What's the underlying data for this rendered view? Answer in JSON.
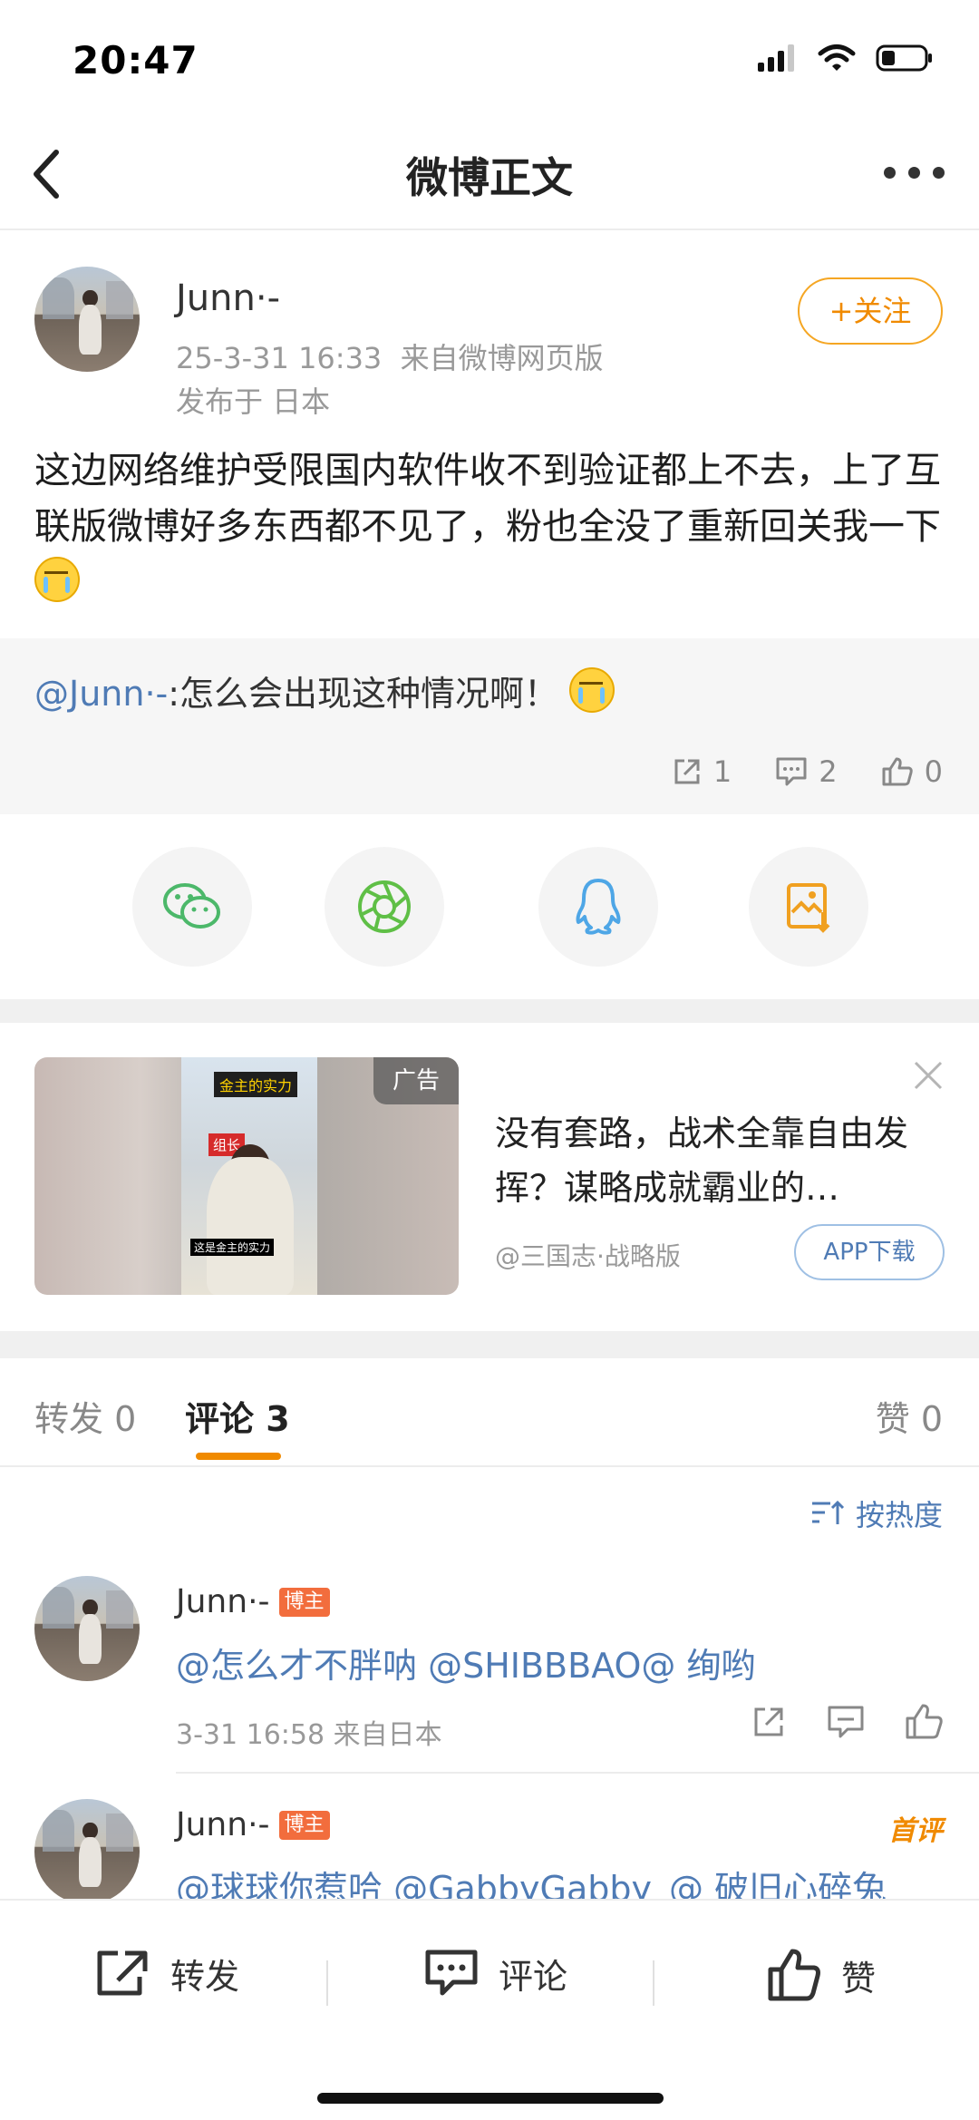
{
  "status_bar": {
    "time": "20:47"
  },
  "nav": {
    "title": "微博正文"
  },
  "post": {
    "author": "Junn·-",
    "timestamp": "25-3-31 16:33",
    "source": "来自微博网页版",
    "location": "发布于 日本",
    "follow_label": "+关注",
    "text": "这边网络维护受限国内软件收不到验证都上不去，上了互联版微博好多东西都不见了，粉也全没了重新回关我一下"
  },
  "quote": {
    "mention": "@Junn·-",
    "text": ":怎么会出现这种情况啊！",
    "reposts": "1",
    "comments": "2",
    "likes": "0"
  },
  "ad": {
    "badge": "广告",
    "title": "没有套路，战术全靠自由发挥？谋略成就霸业的…",
    "source": "@三国志·战略版",
    "button": "APP下载",
    "image_tag_1": "金主的实力",
    "image_tag_2": "组长",
    "image_subtitle": "这是金主的实力"
  },
  "tabs": {
    "repost_label": "转发",
    "repost_count": "0",
    "comment_label": "评论",
    "comment_count": "3",
    "like_label": "赞",
    "like_count": "0"
  },
  "sort_label": "按热度",
  "comments": [
    {
      "author": "Junn·-",
      "badge": "博主",
      "text": "@怎么才不胖呐 @SHIBBBAO@ 绚哟",
      "meta": "3-31 16:58  来自日本"
    },
    {
      "author": "Junn·-",
      "badge": "博主",
      "tag": "首评",
      "text": "@球球你惹哈 @GabbyGabby_@ 破旧心碎兔"
    }
  ],
  "bottom_bar": {
    "repost": "转发",
    "comment": "评论",
    "like": "赞"
  },
  "colors": {
    "accent_orange": "#f08a00",
    "link_blue": "#4f7bb5",
    "host_badge": "#f26d3d"
  }
}
